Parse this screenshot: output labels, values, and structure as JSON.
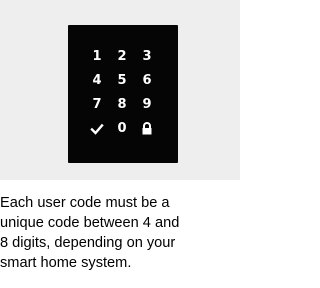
{
  "keypad": {
    "rows": [
      [
        "1",
        "2",
        "3"
      ],
      [
        "4",
        "5",
        "6"
      ],
      [
        "7",
        "8",
        "9"
      ],
      [
        "check-icon",
        "0",
        "lock-icon"
      ]
    ],
    "key_color": "#ffffff",
    "panel_color": "#050505",
    "background_color": "#eeeeee"
  },
  "caption": {
    "lines": [
      "Each user code must be a",
      "unique code between 4 and",
      "8 digits, depending on your",
      "smart home system."
    ]
  }
}
